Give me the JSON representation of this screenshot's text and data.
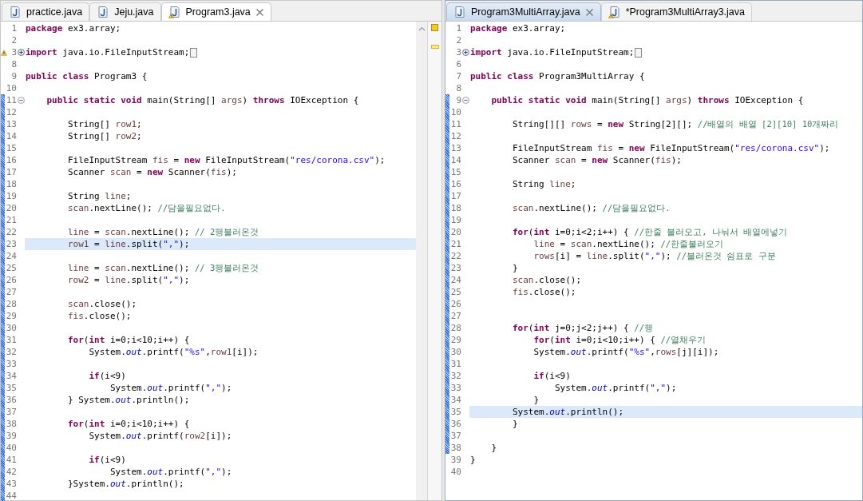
{
  "editors": [
    {
      "active": false,
      "tabs": [
        {
          "label": "practice.java",
          "selected": false,
          "warning": false
        },
        {
          "label": "Jeju.java",
          "selected": false,
          "warning": false
        },
        {
          "label": "Program3.java",
          "selected": true,
          "warning": true
        }
      ],
      "lines": [
        {
          "number": "1",
          "changed": false,
          "highlighted": false,
          "tokens": [
            {
              "kind": "keyword",
              "text": "package"
            },
            {
              "kind": "plain",
              "text": " ex3.array;"
            }
          ]
        },
        {
          "number": "2",
          "changed": false,
          "highlighted": false
        },
        {
          "number": "3",
          "changed": false,
          "highlighted": false,
          "warning": true,
          "expanded": false,
          "folded": true,
          "tokens": [
            {
              "kind": "keyword",
              "text": "import"
            },
            {
              "kind": "plain",
              "text": " java.io.FileInputStream;"
            }
          ]
        },
        {
          "number": "8",
          "changed": false,
          "highlighted": false
        },
        {
          "number": "9",
          "changed": false,
          "highlighted": false,
          "tokens": [
            {
              "kind": "keyword",
              "text": "public"
            },
            {
              "kind": "keyword",
              "text": " class"
            },
            {
              "kind": "plain",
              "text": " Program3 {"
            }
          ]
        },
        {
          "number": "10",
          "changed": false,
          "highlighted": false
        },
        {
          "number": "11",
          "changed": true,
          "highlighted": false,
          "expanded": true,
          "tokens": [
            {
              "kind": "keyword",
              "text": "    public"
            },
            {
              "kind": "keyword",
              "text": " static"
            },
            {
              "kind": "keyword",
              "text": " void"
            },
            {
              "kind": "plain",
              "text": " main(String[] "
            },
            {
              "kind": "variable",
              "text": "args"
            },
            {
              "kind": "plain",
              "text": ") "
            },
            {
              "kind": "keyword",
              "text": "throws"
            },
            {
              "kind": "plain",
              "text": " IOException {"
            }
          ]
        },
        {
          "number": "12",
          "changed": true,
          "highlighted": false
        },
        {
          "number": "13",
          "changed": true,
          "highlighted": false,
          "tokens": [
            {
              "kind": "plain",
              "text": "        String[] "
            },
            {
              "kind": "variable",
              "text": "row1"
            },
            {
              "kind": "plain",
              "text": ";"
            }
          ]
        },
        {
          "number": "14",
          "changed": true,
          "highlighted": false,
          "tokens": [
            {
              "kind": "plain",
              "text": "        String[] "
            },
            {
              "kind": "variable",
              "text": "row2"
            },
            {
              "kind": "plain",
              "text": ";"
            }
          ]
        },
        {
          "number": "15",
          "changed": true,
          "highlighted": false
        },
        {
          "number": "16",
          "changed": true,
          "highlighted": false,
          "tokens": [
            {
              "kind": "plain",
              "text": "        FileInputStream "
            },
            {
              "kind": "variable",
              "text": "fis"
            },
            {
              "kind": "plain",
              "text": " = "
            },
            {
              "kind": "keyword",
              "text": "new"
            },
            {
              "kind": "plain",
              "text": " FileInputStream("
            },
            {
              "kind": "string",
              "text": "\"res/corona.csv\""
            },
            {
              "kind": "plain",
              "text": ");"
            }
          ]
        },
        {
          "number": "17",
          "changed": true,
          "highlighted": false,
          "tokens": [
            {
              "kind": "plain",
              "text": "        Scanner "
            },
            {
              "kind": "variable",
              "text": "scan"
            },
            {
              "kind": "plain",
              "text": " = "
            },
            {
              "kind": "keyword",
              "text": "new"
            },
            {
              "kind": "plain",
              "text": " Scanner("
            },
            {
              "kind": "variable",
              "text": "fis"
            },
            {
              "kind": "plain",
              "text": ");"
            }
          ]
        },
        {
          "number": "18",
          "changed": true,
          "highlighted": false
        },
        {
          "number": "19",
          "changed": true,
          "highlighted": false,
          "tokens": [
            {
              "kind": "plain",
              "text": "        String "
            },
            {
              "kind": "variable",
              "text": "line"
            },
            {
              "kind": "plain",
              "text": ";"
            }
          ]
        },
        {
          "number": "20",
          "changed": true,
          "highlighted": false,
          "tokens": [
            {
              "kind": "variable",
              "text": "        scan"
            },
            {
              "kind": "plain",
              "text": ".nextLine(); "
            },
            {
              "kind": "comment",
              "text": "//담을필요없다."
            }
          ]
        },
        {
          "number": "21",
          "changed": true,
          "highlighted": false
        },
        {
          "number": "22",
          "changed": true,
          "highlighted": false,
          "tokens": [
            {
              "kind": "variable",
              "text": "        line"
            },
            {
              "kind": "plain",
              "text": " = "
            },
            {
              "kind": "variable",
              "text": "scan"
            },
            {
              "kind": "plain",
              "text": ".nextLine(); "
            },
            {
              "kind": "comment",
              "text": "// 2행불러온것"
            }
          ]
        },
        {
          "number": "23",
          "changed": true,
          "highlighted": true,
          "tokens": [
            {
              "kind": "variable",
              "text": "        row1"
            },
            {
              "kind": "plain",
              "text": " = "
            },
            {
              "kind": "variable",
              "text": "line"
            },
            {
              "kind": "plain",
              "text": ".split("
            },
            {
              "kind": "string",
              "text": "\",\""
            },
            {
              "kind": "plain",
              "text": ");"
            }
          ]
        },
        {
          "number": "24",
          "changed": true,
          "highlighted": false
        },
        {
          "number": "25",
          "changed": true,
          "highlighted": false,
          "tokens": [
            {
              "kind": "variable",
              "text": "        line"
            },
            {
              "kind": "plain",
              "text": " = "
            },
            {
              "kind": "variable",
              "text": "scan"
            },
            {
              "kind": "plain",
              "text": ".nextLine(); "
            },
            {
              "kind": "comment",
              "text": "// 3행불러온것"
            }
          ]
        },
        {
          "number": "26",
          "changed": true,
          "highlighted": false,
          "tokens": [
            {
              "kind": "variable",
              "text": "        row2"
            },
            {
              "kind": "plain",
              "text": " = "
            },
            {
              "kind": "variable",
              "text": "line"
            },
            {
              "kind": "plain",
              "text": ".split("
            },
            {
              "kind": "string",
              "text": "\",\""
            },
            {
              "kind": "plain",
              "text": ");"
            }
          ]
        },
        {
          "number": "27",
          "changed": true,
          "highlighted": false
        },
        {
          "number": "28",
          "changed": true,
          "highlighted": false,
          "tokens": [
            {
              "kind": "variable",
              "text": "        scan"
            },
            {
              "kind": "plain",
              "text": ".close();"
            }
          ]
        },
        {
          "number": "29",
          "changed": true,
          "highlighted": false,
          "tokens": [
            {
              "kind": "variable",
              "text": "        fis"
            },
            {
              "kind": "plain",
              "text": ".close();"
            }
          ]
        },
        {
          "number": "30",
          "changed": true,
          "highlighted": false
        },
        {
          "number": "31",
          "changed": true,
          "highlighted": false,
          "tokens": [
            {
              "kind": "keyword",
              "text": "        for"
            },
            {
              "kind": "plain",
              "text": "("
            },
            {
              "kind": "keyword",
              "text": "int"
            },
            {
              "kind": "plain",
              "text": " i=0;i<10;i++) {"
            }
          ]
        },
        {
          "number": "32",
          "changed": true,
          "highlighted": false,
          "tokens": [
            {
              "kind": "plain",
              "text": "            System."
            },
            {
              "kind": "field",
              "text": "out"
            },
            {
              "kind": "plain",
              "text": ".printf("
            },
            {
              "kind": "string",
              "text": "\"%s\""
            },
            {
              "kind": "plain",
              "text": ","
            },
            {
              "kind": "variable",
              "text": "row1"
            },
            {
              "kind": "plain",
              "text": "[i]);"
            }
          ]
        },
        {
          "number": "33",
          "changed": true,
          "highlighted": false
        },
        {
          "number": "34",
          "changed": true,
          "highlighted": false,
          "tokens": [
            {
              "kind": "keyword",
              "text": "            if"
            },
            {
              "kind": "plain",
              "text": "(i<9)"
            }
          ]
        },
        {
          "number": "35",
          "changed": true,
          "highlighted": false,
          "tokens": [
            {
              "kind": "plain",
              "text": "                System."
            },
            {
              "kind": "field",
              "text": "out"
            },
            {
              "kind": "plain",
              "text": ".printf("
            },
            {
              "kind": "string",
              "text": "\",\""
            },
            {
              "kind": "plain",
              "text": ");"
            }
          ]
        },
        {
          "number": "36",
          "changed": true,
          "highlighted": false,
          "tokens": [
            {
              "kind": "plain",
              "text": "        } System."
            },
            {
              "kind": "field",
              "text": "out"
            },
            {
              "kind": "plain",
              "text": ".println();"
            }
          ]
        },
        {
          "number": "37",
          "changed": true,
          "highlighted": false
        },
        {
          "number": "38",
          "changed": true,
          "highlighted": false,
          "tokens": [
            {
              "kind": "keyword",
              "text": "        for"
            },
            {
              "kind": "plain",
              "text": "("
            },
            {
              "kind": "keyword",
              "text": "int"
            },
            {
              "kind": "plain",
              "text": " i=0;i<10;i++) {"
            }
          ]
        },
        {
          "number": "39",
          "changed": true,
          "highlighted": false,
          "tokens": [
            {
              "kind": "plain",
              "text": "            System."
            },
            {
              "kind": "field",
              "text": "out"
            },
            {
              "kind": "plain",
              "text": ".printf("
            },
            {
              "kind": "variable",
              "text": "row2"
            },
            {
              "kind": "plain",
              "text": "[i]);"
            }
          ]
        },
        {
          "number": "40",
          "changed": true,
          "highlighted": false
        },
        {
          "number": "41",
          "changed": true,
          "highlighted": false,
          "tokens": [
            {
              "kind": "keyword",
              "text": "            if"
            },
            {
              "kind": "plain",
              "text": "(i<9)"
            }
          ]
        },
        {
          "number": "42",
          "changed": true,
          "highlighted": false,
          "tokens": [
            {
              "kind": "plain",
              "text": "                System."
            },
            {
              "kind": "field",
              "text": "out"
            },
            {
              "kind": "plain",
              "text": ".printf("
            },
            {
              "kind": "string",
              "text": "\",\""
            },
            {
              "kind": "plain",
              "text": ");"
            }
          ]
        },
        {
          "number": "43",
          "changed": true,
          "highlighted": false,
          "tokens": [
            {
              "kind": "plain",
              "text": "        }System."
            },
            {
              "kind": "field",
              "text": "out"
            },
            {
              "kind": "plain",
              "text": ".println();"
            }
          ]
        },
        {
          "number": "44",
          "changed": true,
          "highlighted": false
        }
      ]
    },
    {
      "active": true,
      "tabs": [
        {
          "label": "Program3MultiArray.java",
          "selected": true,
          "warning": false
        },
        {
          "label": "*Program3MultiArray3.java",
          "selected": false,
          "warning": true
        }
      ],
      "lines": [
        {
          "number": "1",
          "changed": false,
          "highlighted": false,
          "tokens": [
            {
              "kind": "keyword",
              "text": "package"
            },
            {
              "kind": "plain",
              "text": " ex3.array;"
            }
          ]
        },
        {
          "number": "2",
          "changed": false,
          "highlighted": false
        },
        {
          "number": "3",
          "changed": false,
          "highlighted": false,
          "expanded": false,
          "folded": true,
          "tokens": [
            {
              "kind": "keyword",
              "text": "import"
            },
            {
              "kind": "plain",
              "text": " java.io.FileInputStream;"
            }
          ]
        },
        {
          "number": "6",
          "changed": false,
          "highlighted": false
        },
        {
          "number": "7",
          "changed": false,
          "highlighted": false,
          "tokens": [
            {
              "kind": "keyword",
              "text": "public"
            },
            {
              "kind": "keyword",
              "text": " class"
            },
            {
              "kind": "plain",
              "text": " Program3MultiArray {"
            }
          ]
        },
        {
          "number": "8",
          "changed": false,
          "highlighted": false
        },
        {
          "number": "9",
          "changed": true,
          "highlighted": false,
          "expanded": true,
          "tokens": [
            {
              "kind": "keyword",
              "text": "    public"
            },
            {
              "kind": "keyword",
              "text": " static"
            },
            {
              "kind": "keyword",
              "text": " void"
            },
            {
              "kind": "plain",
              "text": " main(String[] "
            },
            {
              "kind": "variable",
              "text": "args"
            },
            {
              "kind": "plain",
              "text": ") "
            },
            {
              "kind": "keyword",
              "text": "throws"
            },
            {
              "kind": "plain",
              "text": " IOException {"
            }
          ]
        },
        {
          "number": "10",
          "changed": true,
          "highlighted": false
        },
        {
          "number": "11",
          "changed": true,
          "highlighted": false,
          "tokens": [
            {
              "kind": "plain",
              "text": "        String[][] "
            },
            {
              "kind": "variable",
              "text": "rows"
            },
            {
              "kind": "plain",
              "text": " = "
            },
            {
              "kind": "keyword",
              "text": "new"
            },
            {
              "kind": "plain",
              "text": " String[2][]; "
            },
            {
              "kind": "comment",
              "text": "//배열의 배열 [2][10] 10개짜리"
            }
          ]
        },
        {
          "number": "12",
          "changed": true,
          "highlighted": false
        },
        {
          "number": "13",
          "changed": true,
          "highlighted": false,
          "tokens": [
            {
              "kind": "plain",
              "text": "        FileInputStream "
            },
            {
              "kind": "variable",
              "text": "fis"
            },
            {
              "kind": "plain",
              "text": " = "
            },
            {
              "kind": "keyword",
              "text": "new"
            },
            {
              "kind": "plain",
              "text": " FileInputStream("
            },
            {
              "kind": "string",
              "text": "\"res/corona.csv\""
            },
            {
              "kind": "plain",
              "text": ");"
            }
          ]
        },
        {
          "number": "14",
          "changed": true,
          "highlighted": false,
          "tokens": [
            {
              "kind": "plain",
              "text": "        Scanner "
            },
            {
              "kind": "variable",
              "text": "scan"
            },
            {
              "kind": "plain",
              "text": " = "
            },
            {
              "kind": "keyword",
              "text": "new"
            },
            {
              "kind": "plain",
              "text": " Scanner("
            },
            {
              "kind": "variable",
              "text": "fis"
            },
            {
              "kind": "plain",
              "text": ");"
            }
          ]
        },
        {
          "number": "15",
          "changed": true,
          "highlighted": false
        },
        {
          "number": "16",
          "changed": true,
          "highlighted": false,
          "tokens": [
            {
              "kind": "plain",
              "text": "        String "
            },
            {
              "kind": "variable",
              "text": "line"
            },
            {
              "kind": "plain",
              "text": ";"
            }
          ]
        },
        {
          "number": "17",
          "changed": true,
          "highlighted": false
        },
        {
          "number": "18",
          "changed": true,
          "highlighted": false,
          "tokens": [
            {
              "kind": "variable",
              "text": "        scan"
            },
            {
              "kind": "plain",
              "text": ".nextLine(); "
            },
            {
              "kind": "comment",
              "text": "//담을필요없다."
            }
          ]
        },
        {
          "number": "19",
          "changed": true,
          "highlighted": false
        },
        {
          "number": "20",
          "changed": true,
          "highlighted": false,
          "tokens": [
            {
              "kind": "keyword",
              "text": "        for"
            },
            {
              "kind": "plain",
              "text": "("
            },
            {
              "kind": "keyword",
              "text": "int"
            },
            {
              "kind": "plain",
              "text": " i=0;i<2;i++) { "
            },
            {
              "kind": "comment",
              "text": "//한줄 불러오고, 나눠서 배열에넣기"
            }
          ]
        },
        {
          "number": "21",
          "changed": true,
          "highlighted": false,
          "tokens": [
            {
              "kind": "variable",
              "text": "            line"
            },
            {
              "kind": "plain",
              "text": " = "
            },
            {
              "kind": "variable",
              "text": "scan"
            },
            {
              "kind": "plain",
              "text": ".nextLine(); "
            },
            {
              "kind": "comment",
              "text": "//한줄불러오기"
            }
          ]
        },
        {
          "number": "22",
          "changed": true,
          "highlighted": false,
          "tokens": [
            {
              "kind": "variable",
              "text": "            rows"
            },
            {
              "kind": "plain",
              "text": "[i] = "
            },
            {
              "kind": "variable",
              "text": "line"
            },
            {
              "kind": "plain",
              "text": ".split("
            },
            {
              "kind": "string",
              "text": "\",\""
            },
            {
              "kind": "plain",
              "text": "); "
            },
            {
              "kind": "comment",
              "text": "//불러온것 쉼표로 구분"
            }
          ]
        },
        {
          "number": "23",
          "changed": true,
          "highlighted": false,
          "tokens": [
            {
              "kind": "plain",
              "text": "        }"
            }
          ]
        },
        {
          "number": "24",
          "changed": true,
          "highlighted": false,
          "tokens": [
            {
              "kind": "variable",
              "text": "        scan"
            },
            {
              "kind": "plain",
              "text": ".close();"
            }
          ]
        },
        {
          "number": "25",
          "changed": true,
          "highlighted": false,
          "tokens": [
            {
              "kind": "variable",
              "text": "        fis"
            },
            {
              "kind": "plain",
              "text": ".close();"
            }
          ]
        },
        {
          "number": "26",
          "changed": true,
          "highlighted": false
        },
        {
          "number": "27",
          "changed": true,
          "highlighted": false
        },
        {
          "number": "28",
          "changed": true,
          "highlighted": false,
          "tokens": [
            {
              "kind": "keyword",
              "text": "        for"
            },
            {
              "kind": "plain",
              "text": "("
            },
            {
              "kind": "keyword",
              "text": "int"
            },
            {
              "kind": "plain",
              "text": " j=0;j<2;j++) { "
            },
            {
              "kind": "comment",
              "text": "//행"
            }
          ]
        },
        {
          "number": "29",
          "changed": true,
          "highlighted": false,
          "tokens": [
            {
              "kind": "keyword",
              "text": "            for"
            },
            {
              "kind": "plain",
              "text": "("
            },
            {
              "kind": "keyword",
              "text": "int"
            },
            {
              "kind": "plain",
              "text": " i=0;i<10;i++) { "
            },
            {
              "kind": "comment",
              "text": "//열채우기"
            }
          ]
        },
        {
          "number": "30",
          "changed": true,
          "highlighted": false,
          "tokens": [
            {
              "kind": "plain",
              "text": "            System."
            },
            {
              "kind": "field",
              "text": "out"
            },
            {
              "kind": "plain",
              "text": ".printf("
            },
            {
              "kind": "string",
              "text": "\"%s\""
            },
            {
              "kind": "plain",
              "text": ","
            },
            {
              "kind": "variable",
              "text": "rows"
            },
            {
              "kind": "plain",
              "text": "[j][i]);"
            }
          ]
        },
        {
          "number": "31",
          "changed": true,
          "highlighted": false
        },
        {
          "number": "32",
          "changed": true,
          "highlighted": false,
          "tokens": [
            {
              "kind": "keyword",
              "text": "            if"
            },
            {
              "kind": "plain",
              "text": "(i<9)"
            }
          ]
        },
        {
          "number": "33",
          "changed": true,
          "highlighted": false,
          "tokens": [
            {
              "kind": "plain",
              "text": "                System."
            },
            {
              "kind": "field",
              "text": "out"
            },
            {
              "kind": "plain",
              "text": ".printf("
            },
            {
              "kind": "string",
              "text": "\",\""
            },
            {
              "kind": "plain",
              "text": ");"
            }
          ]
        },
        {
          "number": "34",
          "changed": true,
          "highlighted": false,
          "tokens": [
            {
              "kind": "plain",
              "text": "            }"
            }
          ]
        },
        {
          "number": "35",
          "changed": true,
          "highlighted": true,
          "tokens": [
            {
              "kind": "plain",
              "text": "        System."
            },
            {
              "kind": "field",
              "text": "out"
            },
            {
              "kind": "plain",
              "text": ".println();"
            }
          ]
        },
        {
          "number": "36",
          "changed": true,
          "highlighted": false,
          "tokens": [
            {
              "kind": "plain",
              "text": "        }"
            }
          ]
        },
        {
          "number": "37",
          "changed": true,
          "highlighted": false
        },
        {
          "number": "38",
          "changed": true,
          "highlighted": false,
          "tokens": [
            {
              "kind": "plain",
              "text": "    }"
            }
          ]
        },
        {
          "number": "39",
          "changed": false,
          "highlighted": false,
          "tokens": [
            {
              "kind": "plain",
              "text": "}"
            }
          ]
        },
        {
          "number": "40",
          "changed": false,
          "highlighted": false
        }
      ]
    }
  ]
}
